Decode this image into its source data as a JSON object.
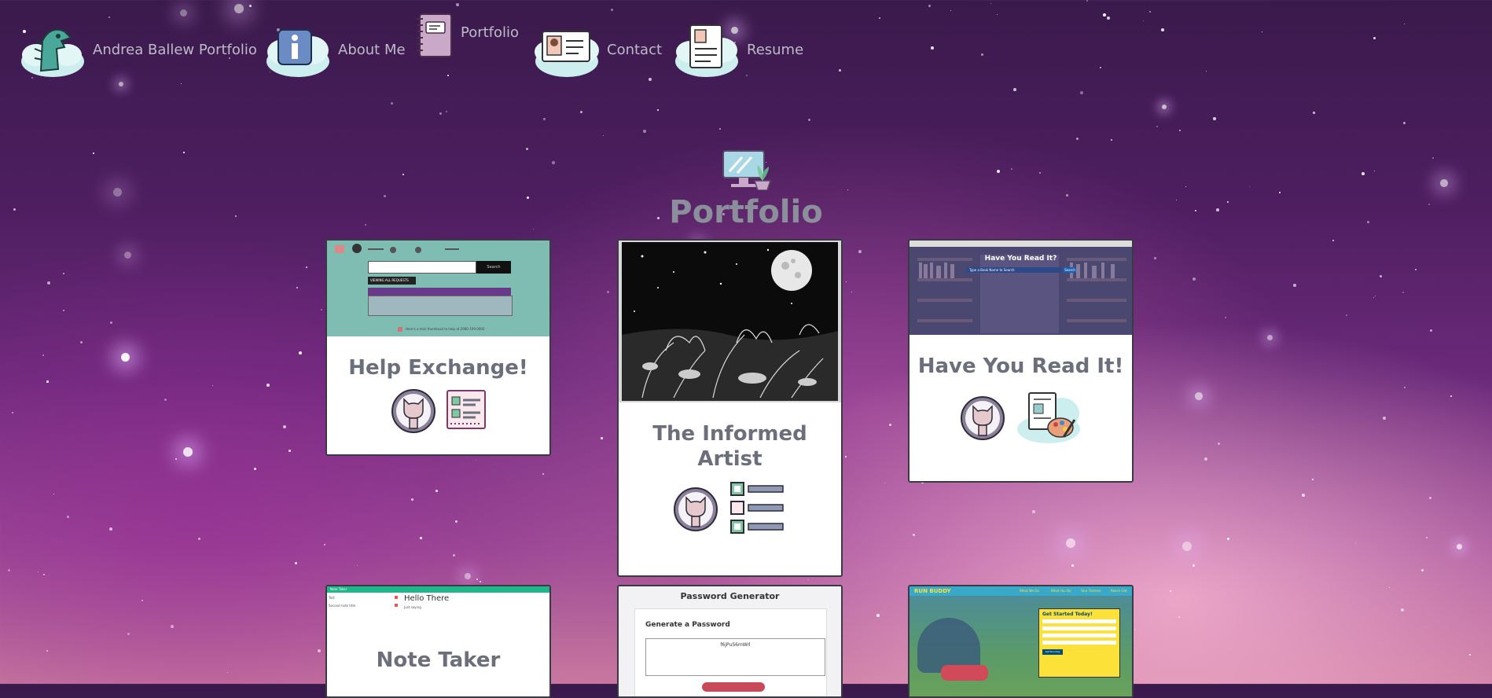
{
  "nav": {
    "items": [
      {
        "label": "Andrea Ballew Portfolio",
        "icon": "dinosaur-icon"
      },
      {
        "label": "About Me",
        "icon": "info-icon"
      },
      {
        "label": "Portfolio",
        "icon": "notebook-icon"
      },
      {
        "label": "Contact",
        "icon": "contact-card-icon"
      },
      {
        "label": "Resume",
        "icon": "resume-icon"
      }
    ]
  },
  "heading": {
    "title": "Portfolio",
    "icon": "computer-plant-icon"
  },
  "projects": [
    {
      "title": "Help Exchange!",
      "icons": [
        "github-icon",
        "checklist-icon"
      ]
    },
    {
      "title": "The Informed Artist",
      "icons": [
        "github-icon",
        "task-list-icon"
      ]
    },
    {
      "title": "Have You Read It!",
      "icons": [
        "github-icon",
        "art-document-icon"
      ]
    },
    {
      "title": "Note Taker",
      "icons": []
    },
    {
      "title": "",
      "icons": []
    },
    {
      "title": "",
      "icons": []
    }
  ],
  "thumbnails": {
    "help_exchange": {
      "button": "VIEWING ALL REQUESTS",
      "search_btn": "Search",
      "footer": "Here's a mini thumbnail to help at 2080-109-0000"
    },
    "have_you_read": {
      "heading": "Have You Read It?",
      "search_placeholder": "Type a Book Name to Search",
      "search_btn": "Search"
    },
    "note_taker": {
      "header": "Note Taker",
      "note_title": "Hello There",
      "note_text": "Just saying",
      "list1": "Test",
      "list2": "Second note title"
    },
    "password": {
      "title": "Password Generator",
      "subtitle": "Generate a Password",
      "output": "f6jPuS6mWrl"
    },
    "run_buddy": {
      "brand": "RUN BUDDY",
      "nav": [
        "What We Do",
        "What You Do",
        "Your Trainers",
        "Reach Out"
      ],
      "form_title": "Get Started Today!",
      "form_btn": "Get Running"
    }
  },
  "colors": {
    "accent_teal": "#7fbcb2",
    "card_border": "#3a3a44",
    "title_gray": "#6b6f7b",
    "nav_text": "#bcbcc6",
    "heading_gray": "#8b8f9c"
  }
}
